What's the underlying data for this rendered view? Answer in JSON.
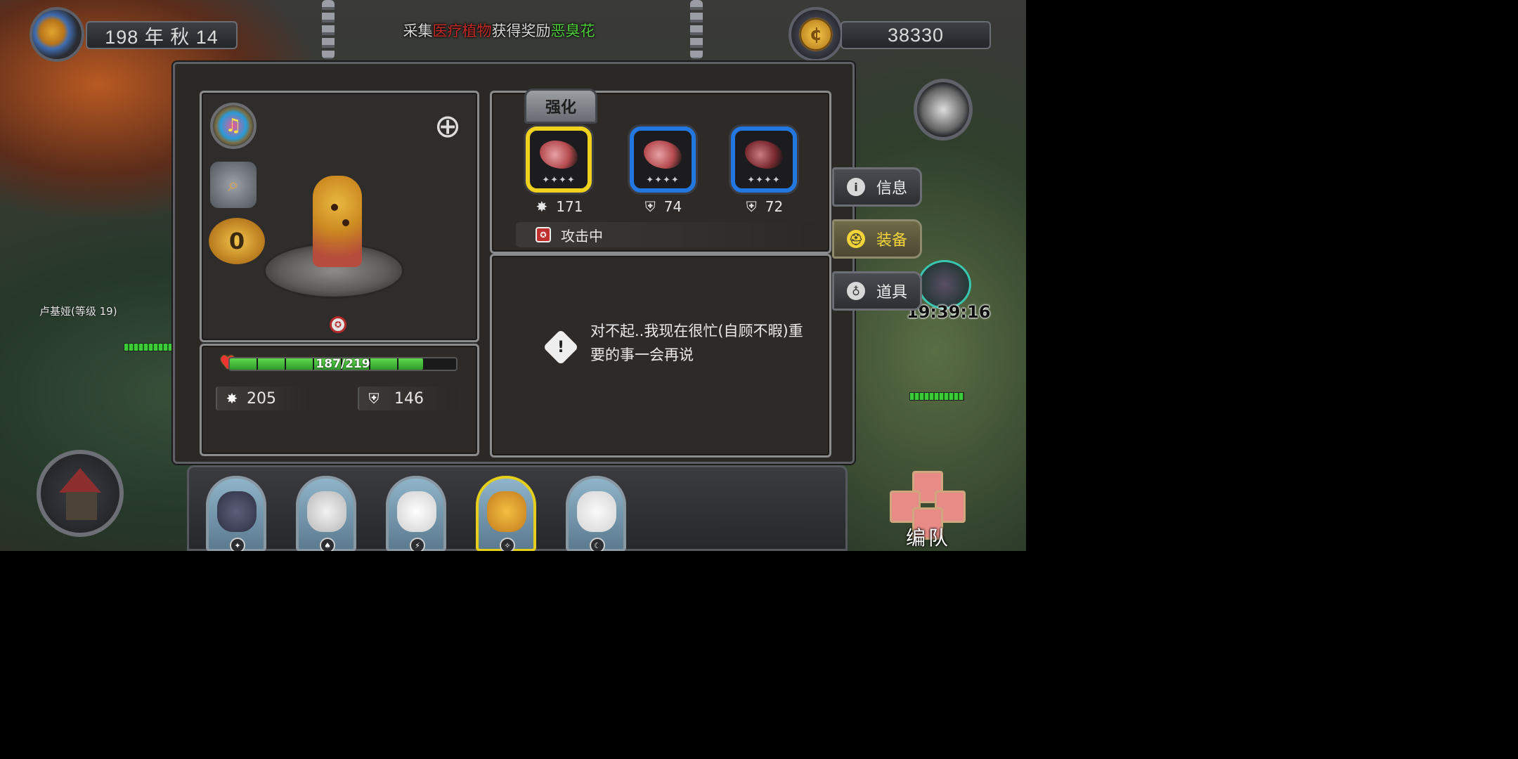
{
  "hud": {
    "date": "198 年 秋 14",
    "gold": "38330"
  },
  "quest": {
    "prefix": "采集",
    "target": "医疗植物",
    "middle": "获得奖励",
    "reward": "恶臭花"
  },
  "character": {
    "level_badge": "0",
    "hp_text": "187/219",
    "hp_fraction": 0.854,
    "attack": "205",
    "defense": "146"
  },
  "equipment": {
    "enhance_label": "强化",
    "slots": [
      {
        "name": "weapon",
        "stars": "✦✦✦✦",
        "stat": "171",
        "stat_icon": "burst-icon",
        "selected": true
      },
      {
        "name": "armor",
        "stars": "✦✦✦✦",
        "stat": "74",
        "stat_icon": "shield-icon",
        "selected": false
      },
      {
        "name": "gloves",
        "stars": "✦✦✦✦",
        "stat": "72",
        "stat_icon": "shield-icon",
        "selected": false
      }
    ],
    "status": "攻击中"
  },
  "dialog": {
    "message": "对不起..我现在很忙(自顾不暇)重要的事一会再说"
  },
  "side_tabs": {
    "info": "信息",
    "equip": "装备",
    "items": "道具"
  },
  "npc": {
    "name": "卢基娅(等级 19)"
  },
  "timer": "19:39:16",
  "team_label": "编队",
  "colors": {
    "quest_target": "#c22a24",
    "quest_reward": "#4ecb3a",
    "slot_selected": "#f0d21e",
    "slot_normal": "#2377e0",
    "tab_active": "#f2d43a",
    "hp_green": "#3ecb3a"
  }
}
